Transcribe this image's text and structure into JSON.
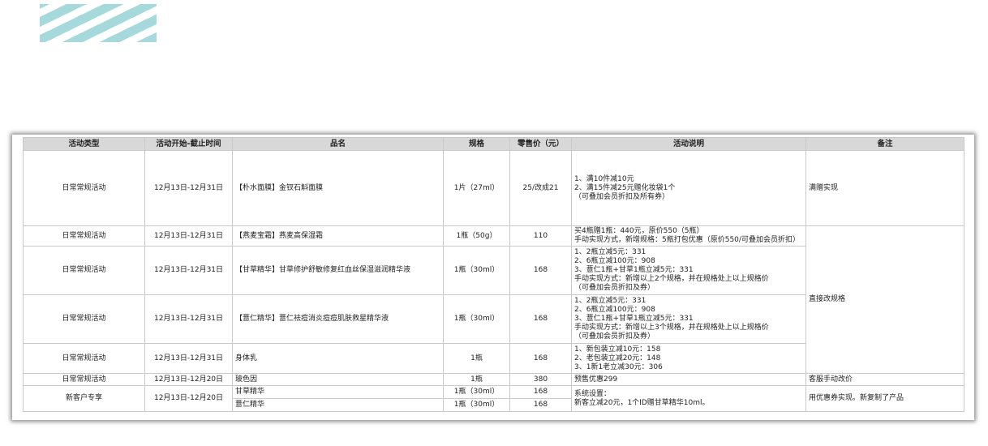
{
  "headers": [
    "活动类型",
    "活动开始-截止时间",
    "品名",
    "规格",
    "零售价（元）",
    "活动说明",
    "备注"
  ],
  "rows": [
    {
      "type": "日常常规活动",
      "period": "12月13日-12月31日",
      "product": "【朴水面膜】金钗石斛面膜",
      "spec": "1片（27ml）",
      "price": "25/改成21",
      "desc": "1、满10件减10元\n2、满15件减25元赠化妆袋1个\n（可叠加会员折扣及所有券）",
      "note": "满赠实现"
    },
    {
      "type": "日常常规活动",
      "period": "12月13日-12月31日",
      "product": "【燕麦宝霜】燕麦高保湿霜",
      "spec": "1瓶（50g）",
      "price": "110",
      "desc": "买4瓶赠1瓶：440元，原价550（5瓶）\n手动实现方式，新增规格：5瓶打包优惠（原价550/可叠加会员折扣）"
    },
    {
      "type": "日常常规活动",
      "period": "12月13日-12月31日",
      "product": "【甘草精华】甘草修护舒敏修复红血丝保湿滋润精华液",
      "spec": "1瓶（30ml）",
      "price": "168",
      "desc": "1、2瓶立减5元：331\n2、6瓶立减100元：908\n3、薏仁1瓶+甘草1瓶立减5元：331\n手动实现方式：新增以上2个规格，并在规格处上以上规格价\n（可叠加会员折扣及券）"
    },
    {
      "type": "日常常规活动",
      "period": "12月13日-12月31日",
      "product": "【薏仁精华】薏仁祛痘消炎痘痘肌肤救星精华液",
      "spec": "1瓶（30ml）",
      "price": "168",
      "desc": "1、2瓶立减5元：331\n2、6瓶立减100元：908\n3、薏仁1瓶+甘草1瓶立减5元：331\n手动实现方式：新增以上3个规格，并在规格处上以上规格价\n（可叠加会员折扣及券）"
    },
    {
      "type": "日常常规活动",
      "period": "12月13日-12月31日",
      "product": "身体乳",
      "spec": "1瓶",
      "price": "168",
      "desc": "1、新包装立减10元：158\n2、老包装立减20元：148\n3、1新1老立减30元：306"
    },
    {
      "type": "日常常规活动",
      "period": "12月13日-12月20日",
      "product": "玻色因",
      "spec": "1瓶",
      "price": "380",
      "desc": "预售优惠299",
      "note": "客服手动改价"
    },
    {
      "type": "新客户专享",
      "period": "12月13日-12月20日",
      "product": "甘草精华",
      "spec": "1瓶（30ml）",
      "price": "168",
      "desc": "系统设置：\n新客立减20元，1个ID赠甘草精华10ml。",
      "note": "用优惠券实现。新复制了产品"
    },
    {
      "product": "薏仁精华",
      "spec": "1瓶（30ml）",
      "price": "168"
    }
  ],
  "merged_note": "直接改规格"
}
